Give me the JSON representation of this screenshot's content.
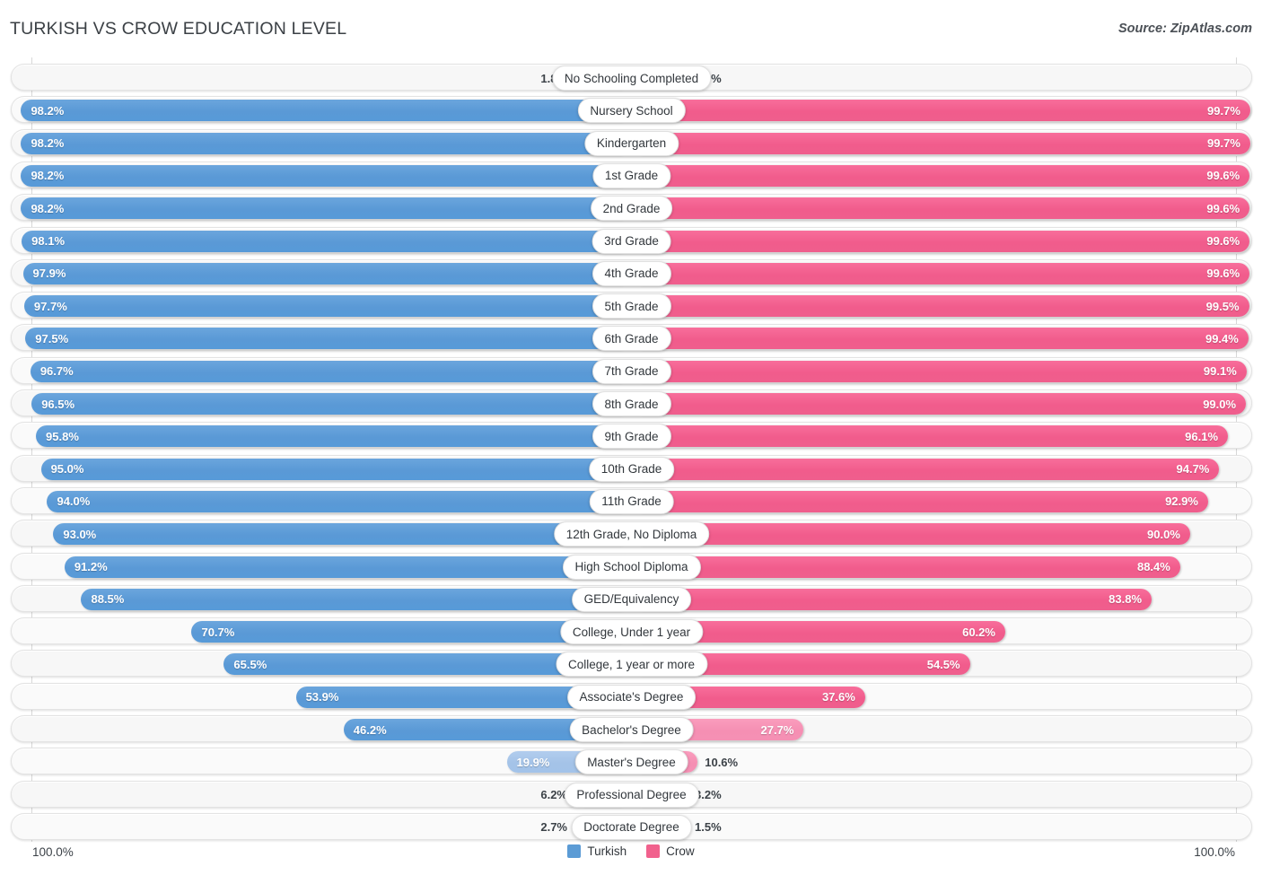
{
  "header": {
    "title": "TURKISH VS CROW EDUCATION LEVEL",
    "source": "Source: ZipAtlas.com"
  },
  "legend": {
    "items": [
      {
        "label": "Turkish",
        "color": "#5b9bd5"
      },
      {
        "label": "Crow",
        "color": "#f1618d"
      }
    ]
  },
  "axis": {
    "left_max": "100.0%",
    "right_max": "100.0%"
  },
  "chart_data": {
    "type": "bar",
    "orientation": "diverging-horizontal",
    "title": "TURKISH VS CROW EDUCATION LEVEL",
    "xlabel": "",
    "ylabel": "",
    "xlim": [
      0,
      100
    ],
    "grid": true,
    "legend_position": "bottom-center",
    "categories": [
      "No Schooling Completed",
      "Nursery School",
      "Kindergarten",
      "1st Grade",
      "2nd Grade",
      "3rd Grade",
      "4th Grade",
      "5th Grade",
      "6th Grade",
      "7th Grade",
      "8th Grade",
      "9th Grade",
      "10th Grade",
      "11th Grade",
      "12th Grade, No Diploma",
      "High School Diploma",
      "GED/Equivalency",
      "College, Under 1 year",
      "College, 1 year or more",
      "Associate's Degree",
      "Bachelor's Degree",
      "Master's Degree",
      "Professional Degree",
      "Doctorate Degree"
    ],
    "series": [
      {
        "name": "Turkish",
        "color": "#5b9bd5",
        "values": [
          1.8,
          98.2,
          98.2,
          98.2,
          98.2,
          98.1,
          97.9,
          97.7,
          97.5,
          96.7,
          96.5,
          95.8,
          95.0,
          94.0,
          93.0,
          91.2,
          88.5,
          70.7,
          65.5,
          53.9,
          46.2,
          19.9,
          6.2,
          2.7
        ]
      },
      {
        "name": "Crow",
        "color": "#f1618d",
        "values": [
          1.6,
          99.7,
          99.7,
          99.6,
          99.6,
          99.6,
          99.6,
          99.5,
          99.4,
          99.1,
          99.0,
          96.1,
          94.7,
          92.9,
          90.0,
          88.4,
          83.8,
          60.2,
          54.5,
          37.6,
          27.7,
          10.6,
          3.2,
          1.5
        ]
      }
    ]
  },
  "rows": [
    {
      "label": "No Schooling Completed",
      "left": "1.8%",
      "right": "1.6%",
      "lv": 1.8,
      "rv": 1.6
    },
    {
      "label": "Nursery School",
      "left": "98.2%",
      "right": "99.7%",
      "lv": 98.2,
      "rv": 99.7
    },
    {
      "label": "Kindergarten",
      "left": "98.2%",
      "right": "99.7%",
      "lv": 98.2,
      "rv": 99.7
    },
    {
      "label": "1st Grade",
      "left": "98.2%",
      "right": "99.6%",
      "lv": 98.2,
      "rv": 99.6
    },
    {
      "label": "2nd Grade",
      "left": "98.2%",
      "right": "99.6%",
      "lv": 98.2,
      "rv": 99.6
    },
    {
      "label": "3rd Grade",
      "left": "98.1%",
      "right": "99.6%",
      "lv": 98.1,
      "rv": 99.6
    },
    {
      "label": "4th Grade",
      "left": "97.9%",
      "right": "99.6%",
      "lv": 97.9,
      "rv": 99.6
    },
    {
      "label": "5th Grade",
      "left": "97.7%",
      "right": "99.5%",
      "lv": 97.7,
      "rv": 99.5
    },
    {
      "label": "6th Grade",
      "left": "97.5%",
      "right": "99.4%",
      "lv": 97.5,
      "rv": 99.4
    },
    {
      "label": "7th Grade",
      "left": "96.7%",
      "right": "99.1%",
      "lv": 96.7,
      "rv": 99.1
    },
    {
      "label": "8th Grade",
      "left": "96.5%",
      "right": "99.0%",
      "lv": 96.5,
      "rv": 99.0
    },
    {
      "label": "9th Grade",
      "left": "95.8%",
      "right": "96.1%",
      "lv": 95.8,
      "rv": 96.1
    },
    {
      "label": "10th Grade",
      "left": "95.0%",
      "right": "94.7%",
      "lv": 95.0,
      "rv": 94.7
    },
    {
      "label": "11th Grade",
      "left": "94.0%",
      "right": "92.9%",
      "lv": 94.0,
      "rv": 92.9
    },
    {
      "label": "12th Grade, No Diploma",
      "left": "93.0%",
      "right": "90.0%",
      "lv": 93.0,
      "rv": 90.0
    },
    {
      "label": "High School Diploma",
      "left": "91.2%",
      "right": "88.4%",
      "lv": 91.2,
      "rv": 88.4
    },
    {
      "label": "GED/Equivalency",
      "left": "88.5%",
      "right": "83.8%",
      "lv": 88.5,
      "rv": 83.8
    },
    {
      "label": "College, Under 1 year",
      "left": "70.7%",
      "right": "60.2%",
      "lv": 70.7,
      "rv": 60.2
    },
    {
      "label": "College, 1 year or more",
      "left": "65.5%",
      "right": "54.5%",
      "lv": 65.5,
      "rv": 54.5
    },
    {
      "label": "Associate's Degree",
      "left": "53.9%",
      "right": "37.6%",
      "lv": 53.9,
      "rv": 37.6
    },
    {
      "label": "Bachelor's Degree",
      "left": "46.2%",
      "right": "27.7%",
      "lv": 46.2,
      "rv": 27.7
    },
    {
      "label": "Master's Degree",
      "left": "19.9%",
      "right": "10.6%",
      "lv": 19.9,
      "rv": 10.6
    },
    {
      "label": "Professional Degree",
      "left": "6.2%",
      "right": "3.2%",
      "lv": 6.2,
      "rv": 3.2
    },
    {
      "label": "Doctorate Degree",
      "left": "2.7%",
      "right": "1.5%",
      "lv": 2.7,
      "rv": 1.5
    }
  ]
}
